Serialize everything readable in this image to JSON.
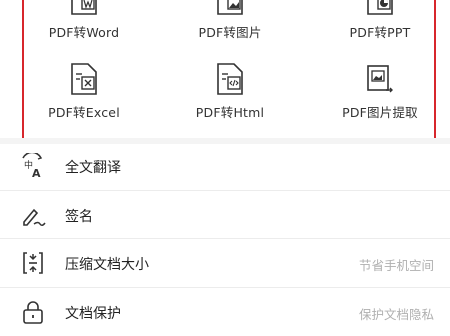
{
  "converters": [
    {
      "label": "PDF转Word",
      "icon": "file-word-icon"
    },
    {
      "label": "PDF转图片",
      "icon": "file-image-icon"
    },
    {
      "label": "PDF转PPT",
      "icon": "file-ppt-icon"
    },
    {
      "label": "PDF转Excel",
      "icon": "file-excel-icon"
    },
    {
      "label": "PDF转Html",
      "icon": "file-html-icon"
    },
    {
      "label": "PDF图片提取",
      "icon": "image-extract-icon"
    }
  ],
  "menu": [
    {
      "label": "全文翻译",
      "hint": "",
      "icon": "translate-icon"
    },
    {
      "label": "签名",
      "hint": "",
      "icon": "signature-icon"
    },
    {
      "label": "压缩文档大小",
      "hint": "节省手机空间",
      "icon": "compress-icon"
    },
    {
      "label": "文档保护",
      "hint": "保护文档隐私",
      "icon": "lock-icon"
    }
  ],
  "colors": {
    "highlight_border": "#d7262c",
    "icon_stroke": "#333333",
    "hint_text": "#b0b0b0"
  }
}
